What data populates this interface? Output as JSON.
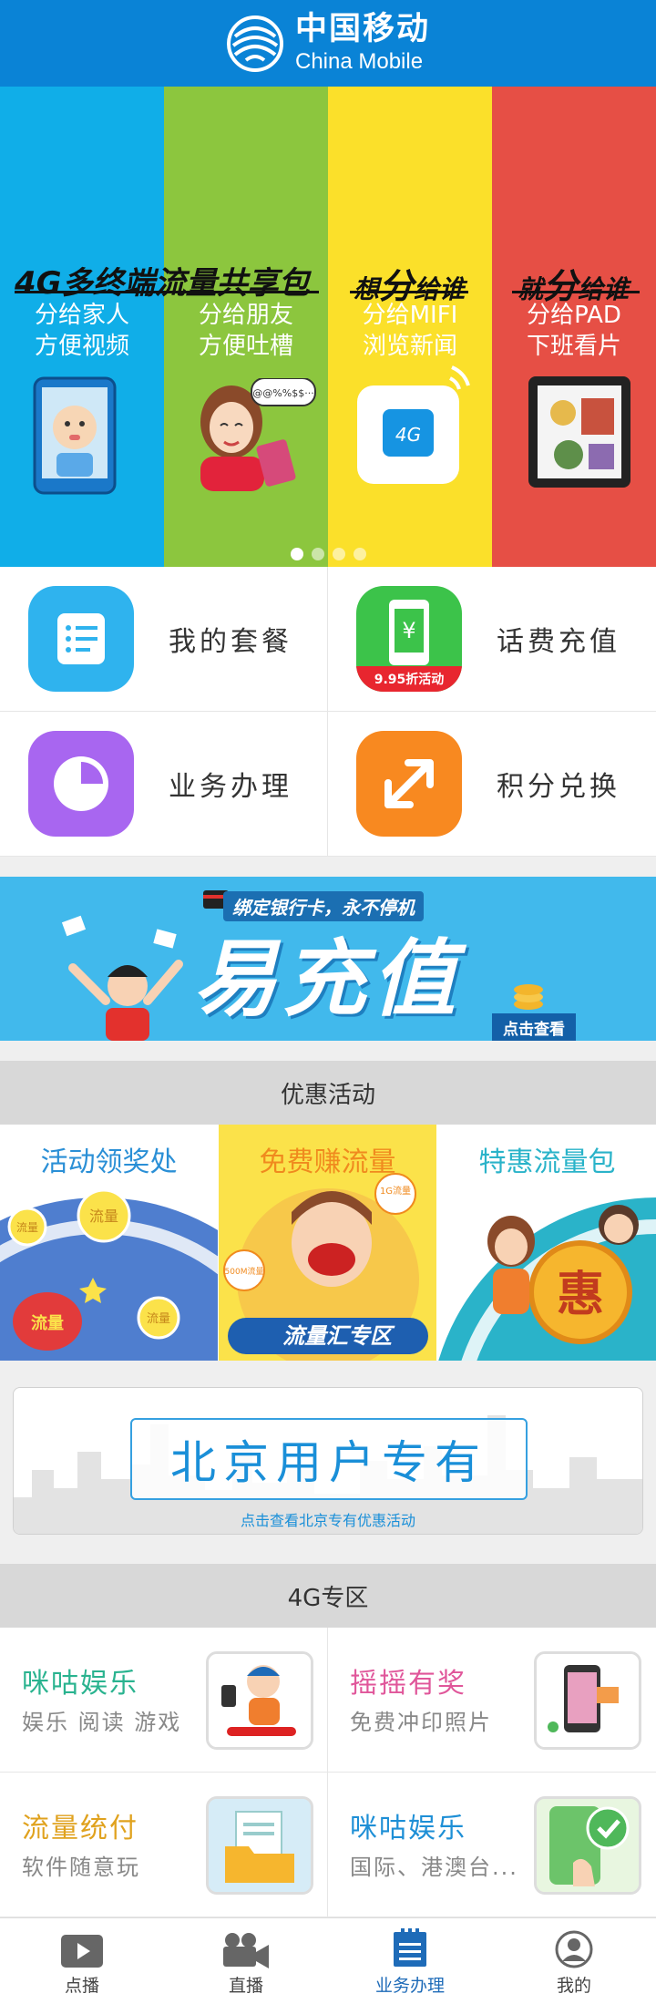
{
  "header": {
    "brand_cn": "中国移动",
    "brand_en": "China Mobile",
    "color": "#0a83d6"
  },
  "banner": {
    "headline": "4G多终端流量共享包",
    "panels": [
      {
        "color": "#10aee8",
        "line1": "分给家人",
        "line2": "方便视频"
      },
      {
        "color": "#8cc63e",
        "line1": "分给朋友",
        "line2": "方便吐槽"
      },
      {
        "color": "#fbe02a",
        "title_a": "想",
        "title_b": "分",
        "title_c": "给谁",
        "line1": "分给MIFI",
        "line2": "浏览新闻"
      },
      {
        "color": "#e64f45",
        "title_a": "就",
        "title_b": "分",
        "title_c": "给谁",
        "line1": "分给PAD",
        "line2": "下班看片"
      }
    ],
    "speech": "@@%%$$···",
    "badge_4g": "4G",
    "dots": 4,
    "active_dot": 1
  },
  "services": [
    {
      "label": "我的套餐",
      "color": "#2fb3ee",
      "icon": "list-icon"
    },
    {
      "label": "话费充值",
      "color": "#3cc34a",
      "icon": "phone-yuan-icon",
      "badge": "9.95折活动"
    },
    {
      "label": "业务办理",
      "color": "#a866f0",
      "icon": "pie-chart-icon"
    },
    {
      "label": "积分兑换",
      "color": "#f88920",
      "icon": "exchange-arrows-icon"
    }
  ],
  "promo": {
    "subtitle": "绑定银行卡，永不停机",
    "title": "易充值",
    "button": "点击查看"
  },
  "activities": {
    "heading": "优惠活动",
    "items": [
      {
        "title": "活动领奖处",
        "title_color": "#2a8fd6",
        "coin_a": "流量",
        "coin_b": "流量",
        "coin_c": "流量",
        "bag": "流量"
      },
      {
        "title": "免费赚流量",
        "title_color": "#f08a1e",
        "tag_a": "1G流量",
        "tag_b": "500M流量",
        "zone_text": "流量汇专区"
      },
      {
        "title": "特惠流量包",
        "title_color": "#2ab3c9",
        "coin": "惠"
      }
    ]
  },
  "beijing": {
    "title": "北京用户专有",
    "link": "点击查看北京专有优惠活动"
  },
  "zone4g": {
    "heading": "4G专区",
    "items": [
      {
        "title": "咪咕娱乐",
        "title_color": "#2ab38f",
        "subtitle": "娱乐 阅读 游戏"
      },
      {
        "title": "摇摇有奖",
        "title_color": "#e0569a",
        "subtitle": "免费冲印照片"
      },
      {
        "title": "流量统付",
        "title_color": "#e0a21e",
        "subtitle": "软件随意玩"
      },
      {
        "title": "咪咕娱乐",
        "title_color": "#1e8fd6",
        "subtitle": "国际、港澳台..."
      }
    ]
  },
  "tabbar": {
    "tabs": [
      {
        "label": "点播",
        "icon": "play-icon"
      },
      {
        "label": "直播",
        "icon": "video-camera-icon"
      },
      {
        "label": "业务办理",
        "icon": "document-icon",
        "active": true
      },
      {
        "label": "我的",
        "icon": "user-icon"
      }
    ]
  }
}
